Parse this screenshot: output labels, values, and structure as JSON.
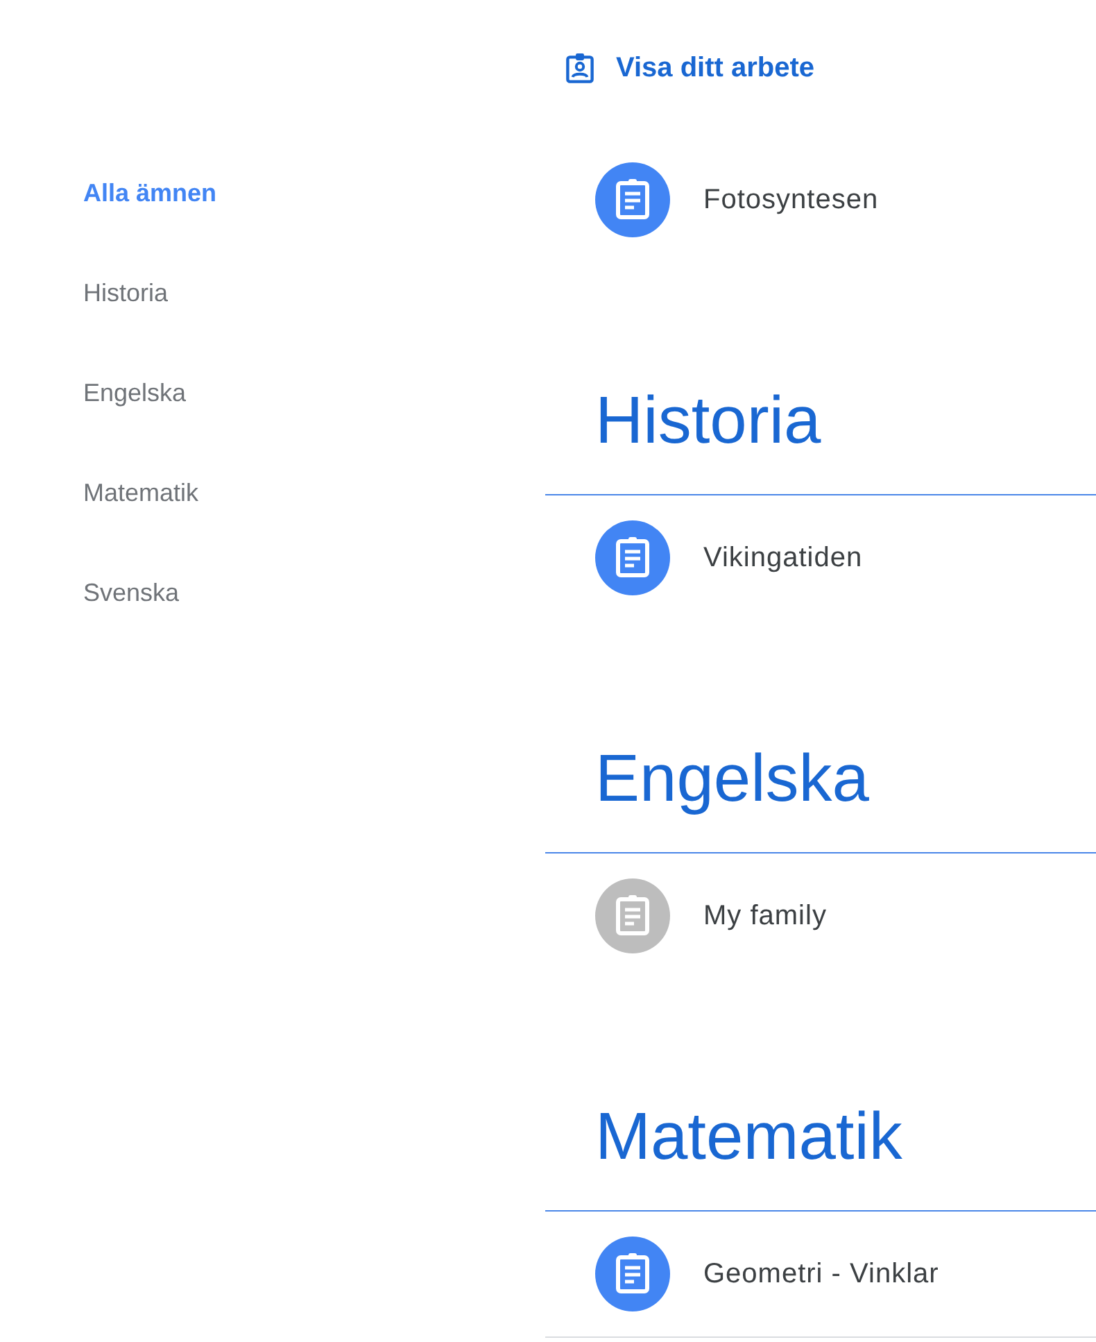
{
  "view_work_link": {
    "label": "Visa ditt arbete"
  },
  "sidebar": {
    "items": [
      {
        "label": "Alla ämnen",
        "selected": true
      },
      {
        "label": "Historia",
        "selected": false
      },
      {
        "label": "Engelska",
        "selected": false
      },
      {
        "label": "Matematik",
        "selected": false
      },
      {
        "label": "Svenska",
        "selected": false
      }
    ]
  },
  "ungrouped_assignments": [
    {
      "title": "Fotosyntesen",
      "color": "#4285f4"
    }
  ],
  "topics": [
    {
      "title": "Historia",
      "assignments": [
        {
          "title": "Vikingatiden",
          "color": "#4285f4"
        }
      ]
    },
    {
      "title": "Engelska",
      "assignments": [
        {
          "title": "My family",
          "color": "#bdbdbd"
        }
      ]
    },
    {
      "title": "Matematik",
      "assignments": [
        {
          "title": "Geometri - Vinklar",
          "color": "#4285f4"
        }
      ]
    }
  ]
}
